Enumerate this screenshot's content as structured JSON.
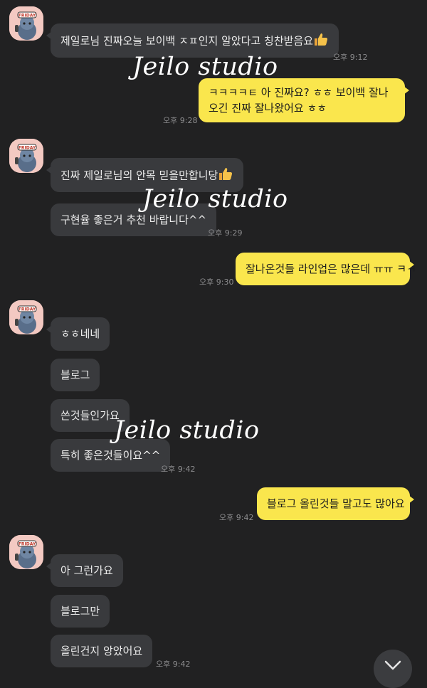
{
  "messages": [
    {
      "text": "제일로님 진짜오늘 보이백 ㅈㅍ인지 알았다고 칭찬받음요",
      "emoji": "thumbs-up",
      "time": "오후 9:12"
    },
    {
      "text": "ㅋㅋㅋㅋㅌ 아 진짜요? ㅎㅎ 보이백 잘나오긴 진짜 잘나왔어요 ㅎㅎ",
      "time": "오후 9:28"
    },
    {
      "text": "진짜 제일로님의 안목 믿을만합니당",
      "emoji": "thumbs-up"
    },
    {
      "text": "구현율 좋은거 추천 바랍니다^^",
      "time": "오후 9:29"
    },
    {
      "text": "잘나온것들 라인업은 많은데 ㅠㅠ ㅋㅋ",
      "time": "오후 9:30"
    },
    {
      "text": "ㅎㅎ네네"
    },
    {
      "text": "블로그"
    },
    {
      "text": "쓴것들인가요"
    },
    {
      "text": "특히 좋은것들이요^^",
      "time": "오후 9:42"
    },
    {
      "text": "블로그 올린것들 말고도 많아요",
      "time": "오후 9:42"
    },
    {
      "text": "아 그런가요"
    },
    {
      "text": "블로그만"
    },
    {
      "text": "올린건지 앙았어요",
      "time": "오후 9:42"
    }
  ],
  "watermark": "Jeilo studio",
  "avatar_label": "FRIDAY",
  "colors": {
    "background": "#212122",
    "incoming": "#393a3d",
    "outgoing": "#fae64d"
  },
  "scroll_button_icon": "chevron-down-icon"
}
